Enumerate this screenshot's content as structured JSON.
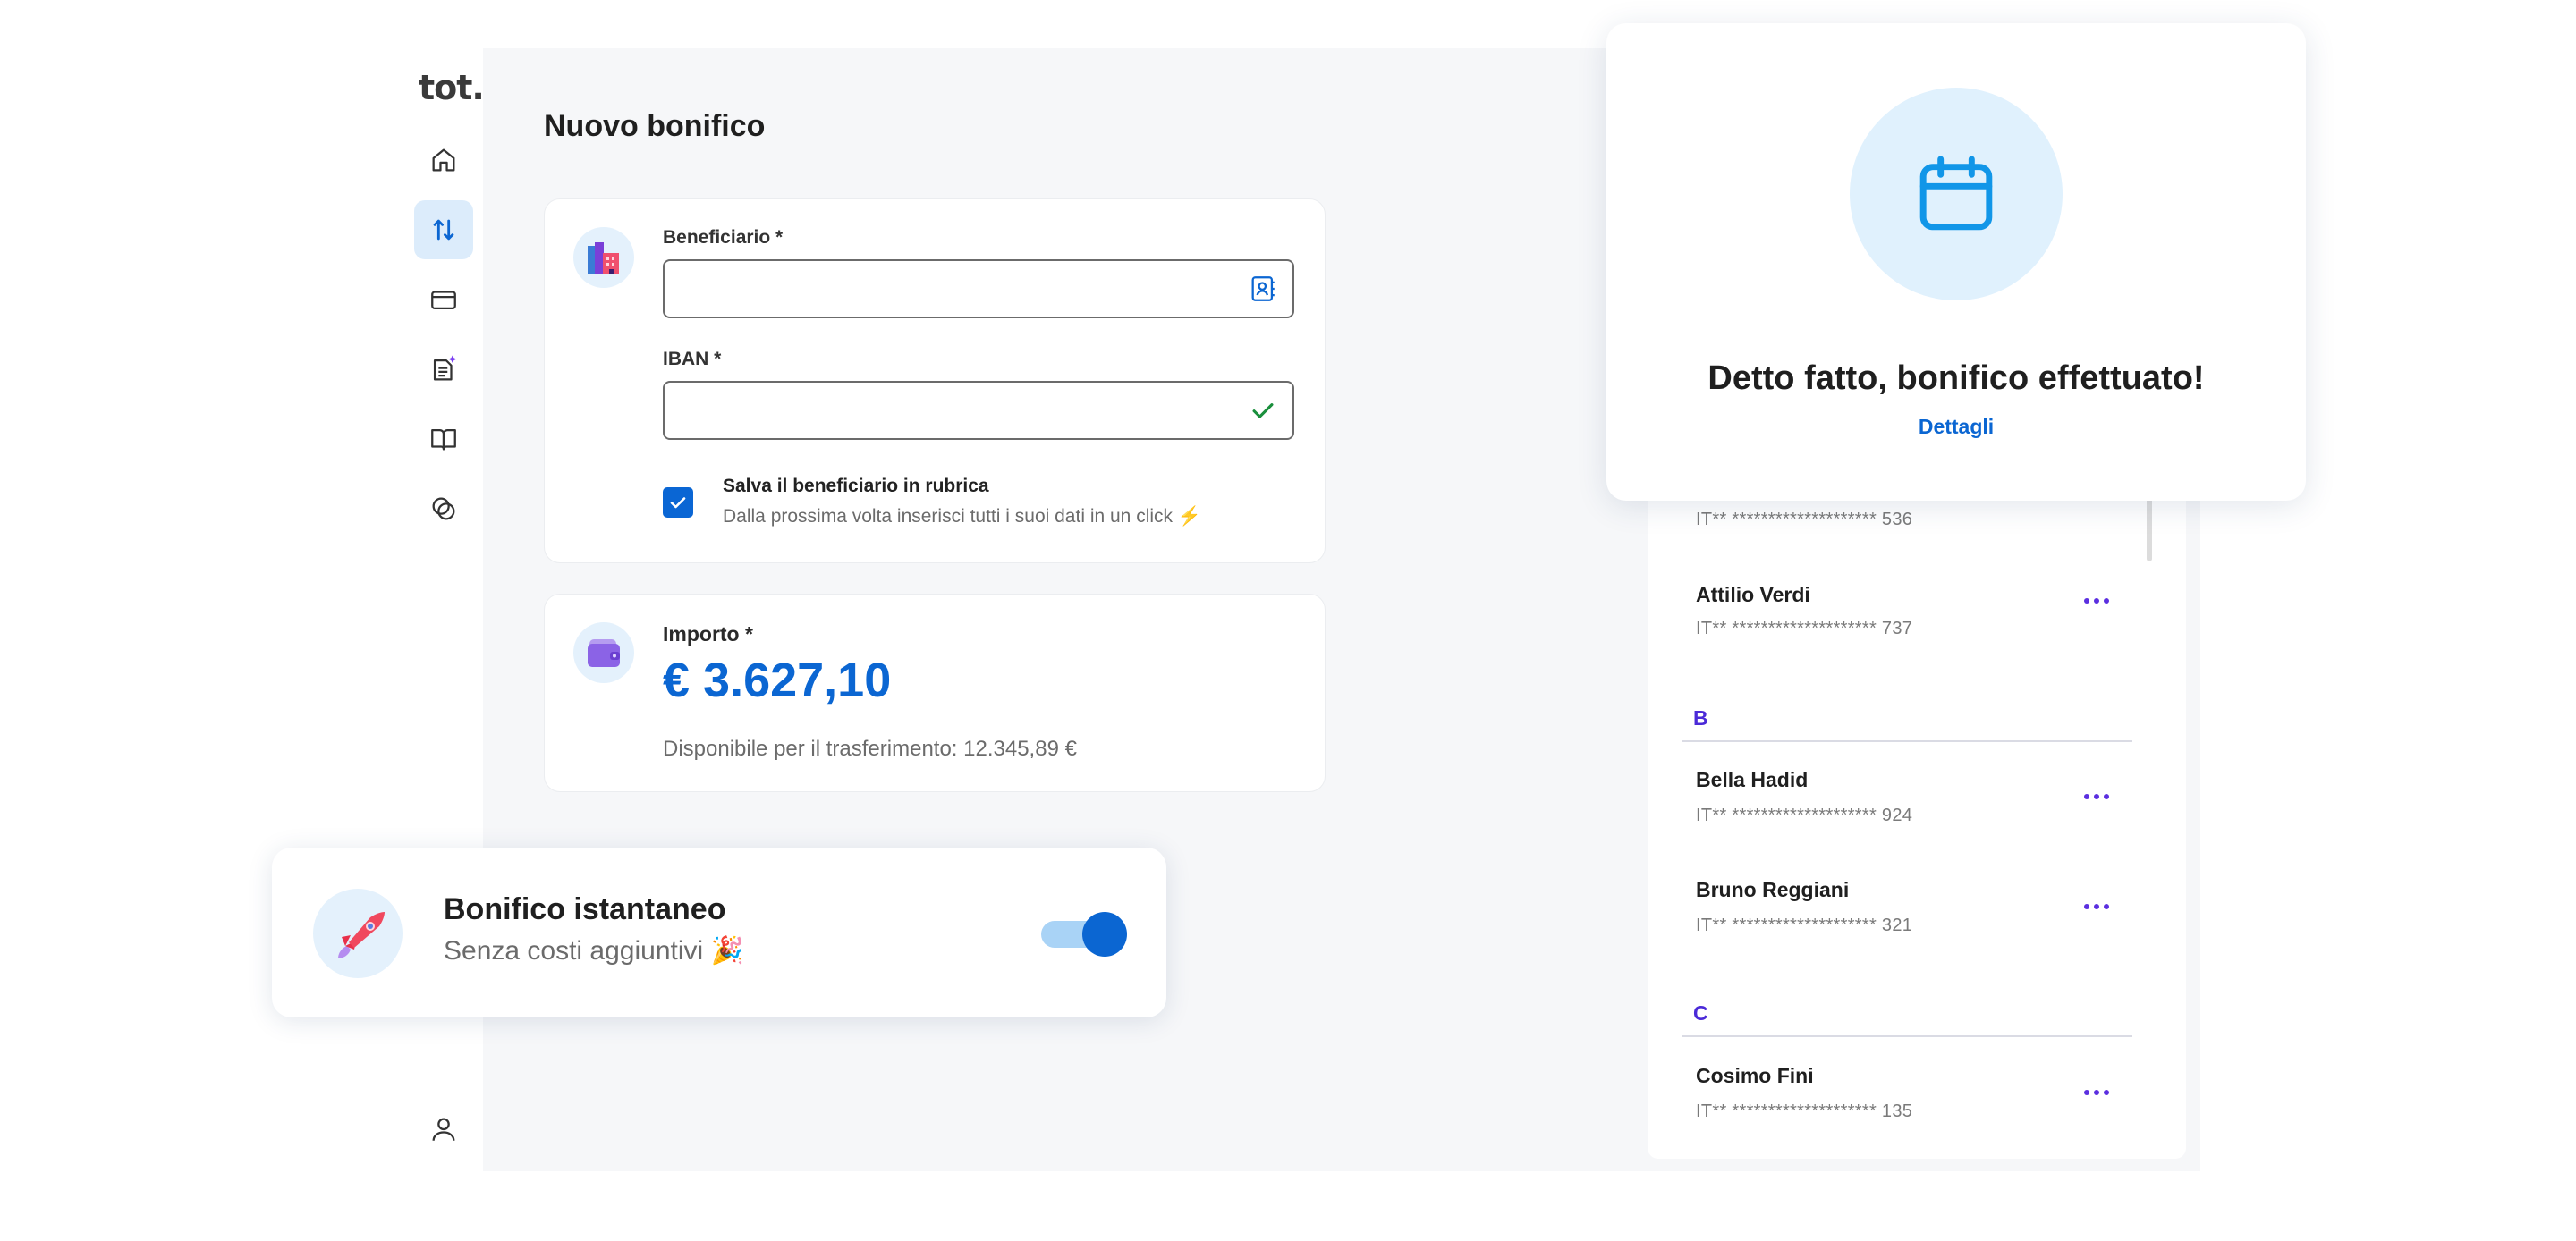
{
  "app": {
    "logo": "tot."
  },
  "sidebar": {
    "items": [
      {
        "icon": "home-icon"
      },
      {
        "icon": "transfer-arrows-icon",
        "active": true
      },
      {
        "icon": "card-icon"
      },
      {
        "icon": "document-sparkle-icon"
      },
      {
        "icon": "book-icon"
      },
      {
        "icon": "circles-icon"
      }
    ],
    "bottom_icon": "user-icon"
  },
  "page": {
    "title": "Nuovo bonifico"
  },
  "beneficiary_form": {
    "beneficiary_label": "Beneficiario *",
    "beneficiary_value": "",
    "iban_label": "IBAN *",
    "iban_value": "",
    "save_checkbox": {
      "checked": true,
      "title": "Salva il beneficiario in rubrica",
      "subtitle": "Dalla prossima volta inserisci tutti i suoi dati in un click ⚡"
    }
  },
  "amount": {
    "label": "Importo *",
    "value": "€ 3.627,10",
    "available": "Disponibile per il trasferimento: 12.345,89 €"
  },
  "instant": {
    "title": "Bonifico istantaneo",
    "subtitle": "Senza costi aggiuntivi 🎉",
    "enabled": true
  },
  "contacts": {
    "partial_iban": "IT** ******************** 536",
    "groups": [
      {
        "letter": "",
        "items": [
          {
            "name": "Attilio Verdi",
            "iban": "IT** ******************** 737"
          }
        ]
      },
      {
        "letter": "B",
        "items": [
          {
            "name": "Bella Hadid",
            "iban": "IT** ******************** 924"
          },
          {
            "name": "Bruno Reggiani",
            "iban": "IT** ******************** 321"
          }
        ]
      },
      {
        "letter": "C",
        "items": [
          {
            "name": "Cosimo Fini",
            "iban": "IT** ******************** 135"
          }
        ]
      }
    ]
  },
  "popup": {
    "title": "Detto fatto, bonifico effettuato!",
    "link": "Dettagli"
  },
  "colors": {
    "accent": "#0b66d2",
    "accent_light": "#e0f1fd",
    "letter": "#4b2ad8"
  }
}
